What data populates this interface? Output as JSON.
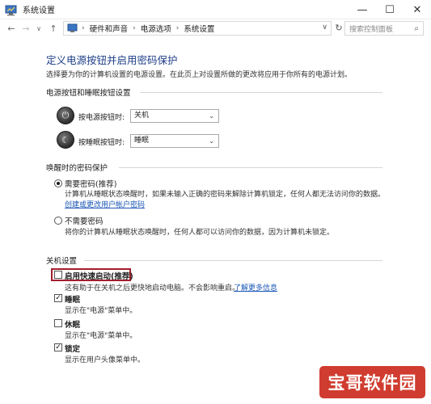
{
  "window": {
    "title": "系统设置",
    "controls": {
      "minimize": "—",
      "maximize": "☐",
      "close": "✕"
    }
  },
  "addressbar": {
    "back": "←",
    "forward": "→",
    "dropdown": "∨",
    "up": "↑",
    "breadcrumbs": [
      "硬件和声音",
      "电源选项",
      "系统设置"
    ],
    "separator": "›",
    "path_dropdown": "∨",
    "refresh": "↻",
    "search_placeholder": "搜索控制面板",
    "search_icon": "⌕"
  },
  "main": {
    "heading": "定义电源按钮并启用密码保护",
    "subtitle": "选择要为你的计算机设置的电源设置。在此页上对设置所做的更改将应用于你所有的电源计划。",
    "power_section": {
      "label": "电源按钮和睡眠按钮设置",
      "rows": [
        {
          "label": "按电源按钮时:",
          "value": "关机",
          "icon": "power-icon"
        },
        {
          "label": "按睡眠按钮时:",
          "value": "睡眠",
          "icon": "sleep-icon"
        }
      ],
      "arrow": "⌄"
    },
    "password_section": {
      "label": "唤醒时的密码保护",
      "options": [
        {
          "title": "需要密码(推荐)",
          "desc": "计算机从睡眠状态唤醒时，如果未输入正确的密码来解除计算机锁定，任何人都无法访问你的数据。",
          "link": "创建或更改用户帐户密码",
          "checked": true
        },
        {
          "title": "不需要密码",
          "desc": "将你的计算机从睡眠状态唤醒时，任何人都可以访问你的数据，因为计算机未锁定。",
          "checked": false
        }
      ]
    },
    "shutdown_section": {
      "label": "关机设置",
      "items": [
        {
          "title": "启用快速启动(推荐)",
          "desc": "这有助于在关机之后更快地启动电脑。不会影响重启。",
          "link": "了解更多信息",
          "checked": false,
          "highlighted": true
        },
        {
          "title": "睡眠",
          "desc": "显示在\"电源\"菜单中。",
          "checked": true
        },
        {
          "title": "休眠",
          "desc": "显示在\"电源\"菜单中。",
          "checked": false
        },
        {
          "title": "锁定",
          "desc": "显示在用户头像菜单中。",
          "checked": true
        }
      ]
    }
  },
  "watermark": "宝哥软件园",
  "colors": {
    "heading": "#1e3e88",
    "link": "#1a56b5",
    "highlight": "#a31e2b",
    "watermark_bg": "#d03c2f"
  }
}
